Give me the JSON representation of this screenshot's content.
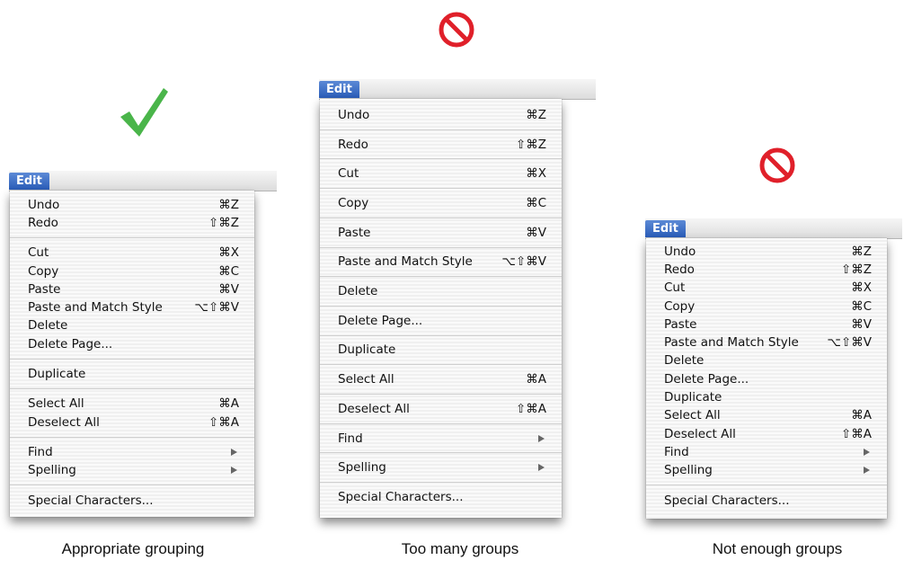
{
  "panels": [
    {
      "id": "appropriate",
      "menu_title": "Edit",
      "verdict_icon": "checkmark-icon",
      "verdict_color": "#4ab54a",
      "caption": "Appropriate grouping",
      "groups": [
        [
          {
            "label": "Undo",
            "shortcut": "⌘Z"
          },
          {
            "label": "Redo",
            "shortcut": "⇧⌘Z"
          }
        ],
        [
          {
            "label": "Cut",
            "shortcut": "⌘X"
          },
          {
            "label": "Copy",
            "shortcut": "⌘C"
          },
          {
            "label": "Paste",
            "shortcut": "⌘V"
          },
          {
            "label": "Paste and Match Style",
            "shortcut": "⌥⇧⌘V"
          },
          {
            "label": "Delete",
            "shortcut": ""
          },
          {
            "label": "Delete Page...",
            "shortcut": ""
          }
        ],
        [
          {
            "label": "Duplicate",
            "shortcut": ""
          }
        ],
        [
          {
            "label": "Select All",
            "shortcut": "⌘A"
          },
          {
            "label": "Deselect All",
            "shortcut": "⇧⌘A"
          }
        ],
        [
          {
            "label": "Find",
            "submenu": true
          },
          {
            "label": "Spelling",
            "submenu": true
          }
        ],
        [
          {
            "label": "Special Characters...",
            "shortcut": ""
          }
        ]
      ]
    },
    {
      "id": "too-many",
      "menu_title": "Edit",
      "verdict_icon": "prohibited-icon",
      "verdict_color": "#e0202a",
      "caption": "Too many groups",
      "groups": [
        [
          {
            "label": "Undo",
            "shortcut": "⌘Z"
          }
        ],
        [
          {
            "label": "Redo",
            "shortcut": "⇧⌘Z"
          }
        ],
        [
          {
            "label": "Cut",
            "shortcut": "⌘X"
          }
        ],
        [
          {
            "label": "Copy",
            "shortcut": "⌘C"
          }
        ],
        [
          {
            "label": "Paste",
            "shortcut": "⌘V"
          }
        ],
        [
          {
            "label": "Paste and Match Style",
            "shortcut": "⌥⇧⌘V"
          }
        ],
        [
          {
            "label": "Delete",
            "shortcut": ""
          }
        ],
        [
          {
            "label": "Delete Page...",
            "shortcut": ""
          }
        ],
        [
          {
            "label": "Duplicate",
            "shortcut": ""
          }
        ],
        [
          {
            "label": "Select All",
            "shortcut": "⌘A"
          }
        ],
        [
          {
            "label": "Deselect All",
            "shortcut": "⇧⌘A"
          }
        ],
        [
          {
            "label": "Find",
            "submenu": true
          }
        ],
        [
          {
            "label": "Spelling",
            "submenu": true
          }
        ],
        [
          {
            "label": "Special Characters...",
            "shortcut": ""
          }
        ]
      ]
    },
    {
      "id": "not-enough",
      "menu_title": "Edit",
      "verdict_icon": "prohibited-icon",
      "verdict_color": "#e0202a",
      "caption": "Not enough groups",
      "groups": [
        [
          {
            "label": "Undo",
            "shortcut": "⌘Z"
          },
          {
            "label": "Redo",
            "shortcut": "⇧⌘Z"
          },
          {
            "label": "Cut",
            "shortcut": "⌘X"
          },
          {
            "label": "Copy",
            "shortcut": "⌘C"
          },
          {
            "label": "Paste",
            "shortcut": "⌘V"
          },
          {
            "label": "Paste and Match Style",
            "shortcut": "⌥⇧⌘V"
          },
          {
            "label": "Delete",
            "shortcut": ""
          },
          {
            "label": "Delete Page...",
            "shortcut": ""
          },
          {
            "label": "Duplicate",
            "shortcut": ""
          },
          {
            "label": "Select All",
            "shortcut": "⌘A"
          },
          {
            "label": "Deselect All",
            "shortcut": "⇧⌘A"
          },
          {
            "label": "Find",
            "submenu": true
          },
          {
            "label": "Spelling",
            "submenu": true
          }
        ],
        [
          {
            "label": "Special Characters...",
            "shortcut": ""
          }
        ]
      ]
    }
  ]
}
